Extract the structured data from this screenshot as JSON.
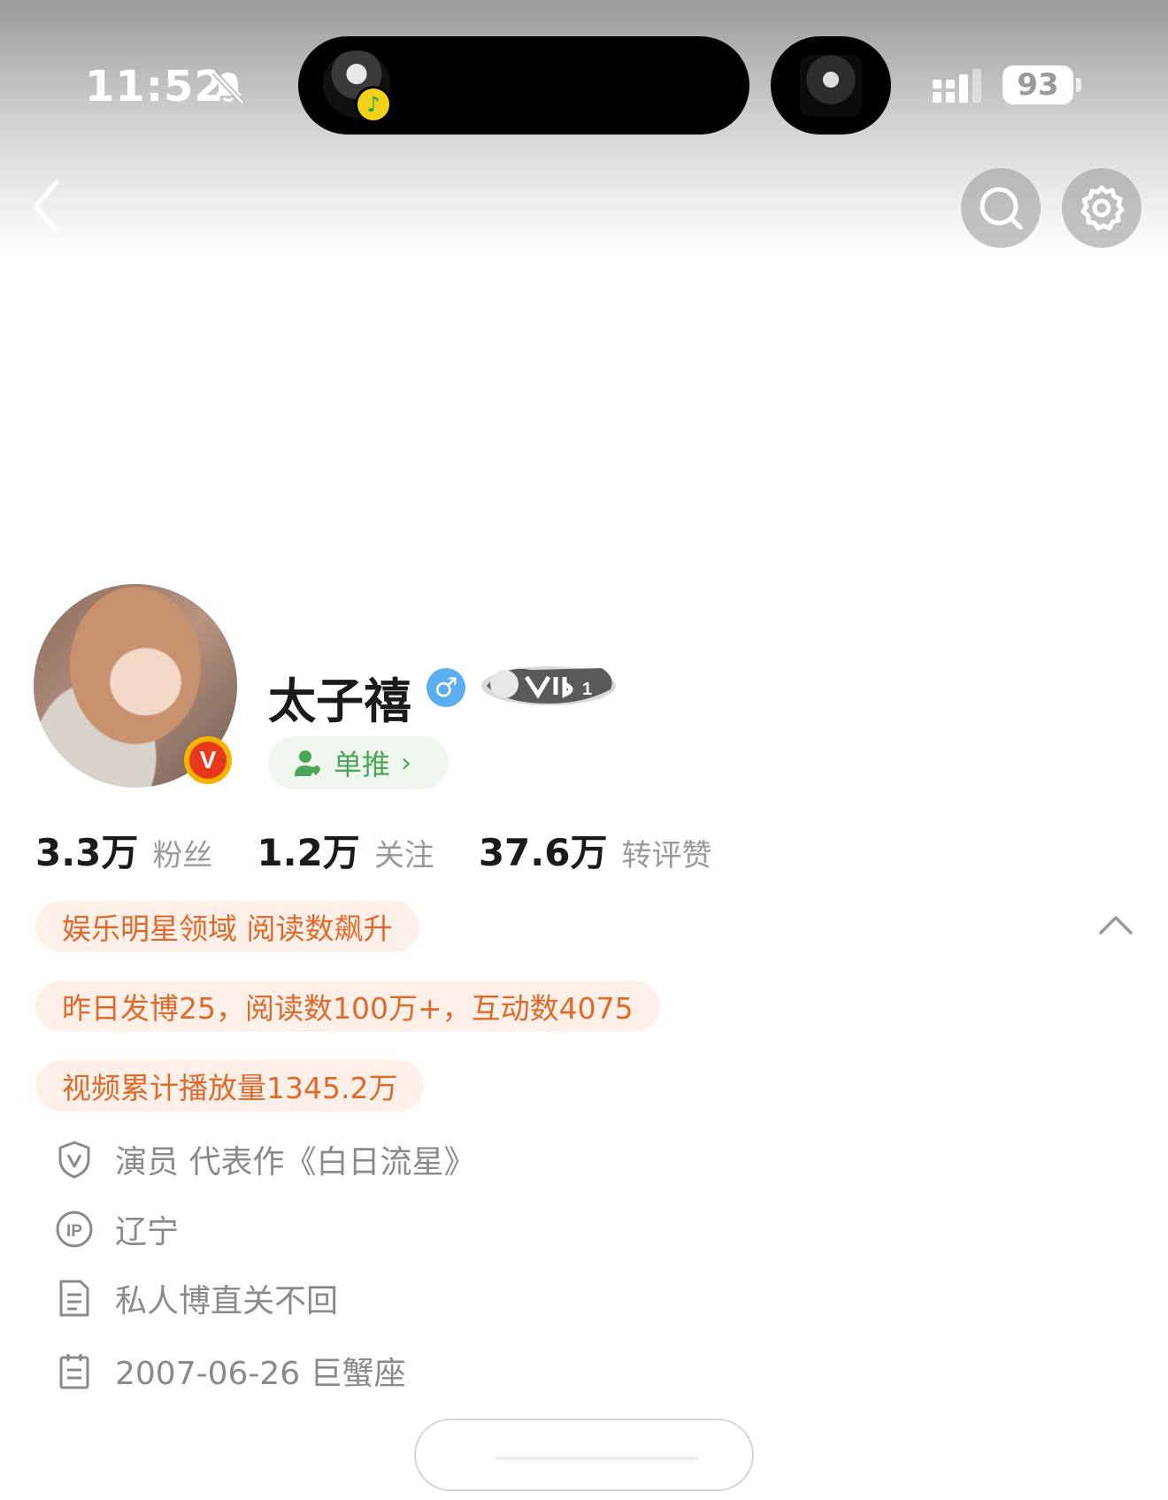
{
  "status_bar": {
    "time": "11:52",
    "battery": "93",
    "icons": [
      "bell-muted-icon",
      "music-icon",
      "signal-icon",
      "battery-icon"
    ]
  },
  "nav": {
    "icons": [
      "back-icon",
      "search-icon",
      "settings-icon"
    ]
  },
  "profile": {
    "username": "太子禧",
    "gender_symbol": "♂",
    "verified_badge": "V",
    "single_push_label": "单推",
    "single_push_chevron": "›"
  },
  "stats": [
    {
      "value": "3.3万",
      "label": "粉丝"
    },
    {
      "value": "1.2万",
      "label": "关注"
    },
    {
      "value": "37.6万",
      "label": "转评赞"
    }
  ],
  "tags": [
    "娱乐明星领域 阅读数飙升",
    "昨日发博25，阅读数100万+，互动数4075",
    "视频累计播放量1345.2万"
  ],
  "info": [
    {
      "icon": "shield-v-icon",
      "text": "演员 代表作《白日流星》"
    },
    {
      "icon": "ip-icon",
      "text": "辽宁"
    },
    {
      "icon": "document-icon",
      "text": "私人博直关不回"
    },
    {
      "icon": "calendar-icon",
      "text": "2007-06-26 巨蟹座"
    }
  ],
  "colors": {
    "tag_bg": "#fdf0e8",
    "tag_text": "#e06a2c",
    "push_bg": "#eef6ee",
    "push_text": "#4aa55a",
    "gender_blue": "#5aaef0",
    "verified_red": "#e8391f",
    "verified_gold": "#f6b400"
  }
}
